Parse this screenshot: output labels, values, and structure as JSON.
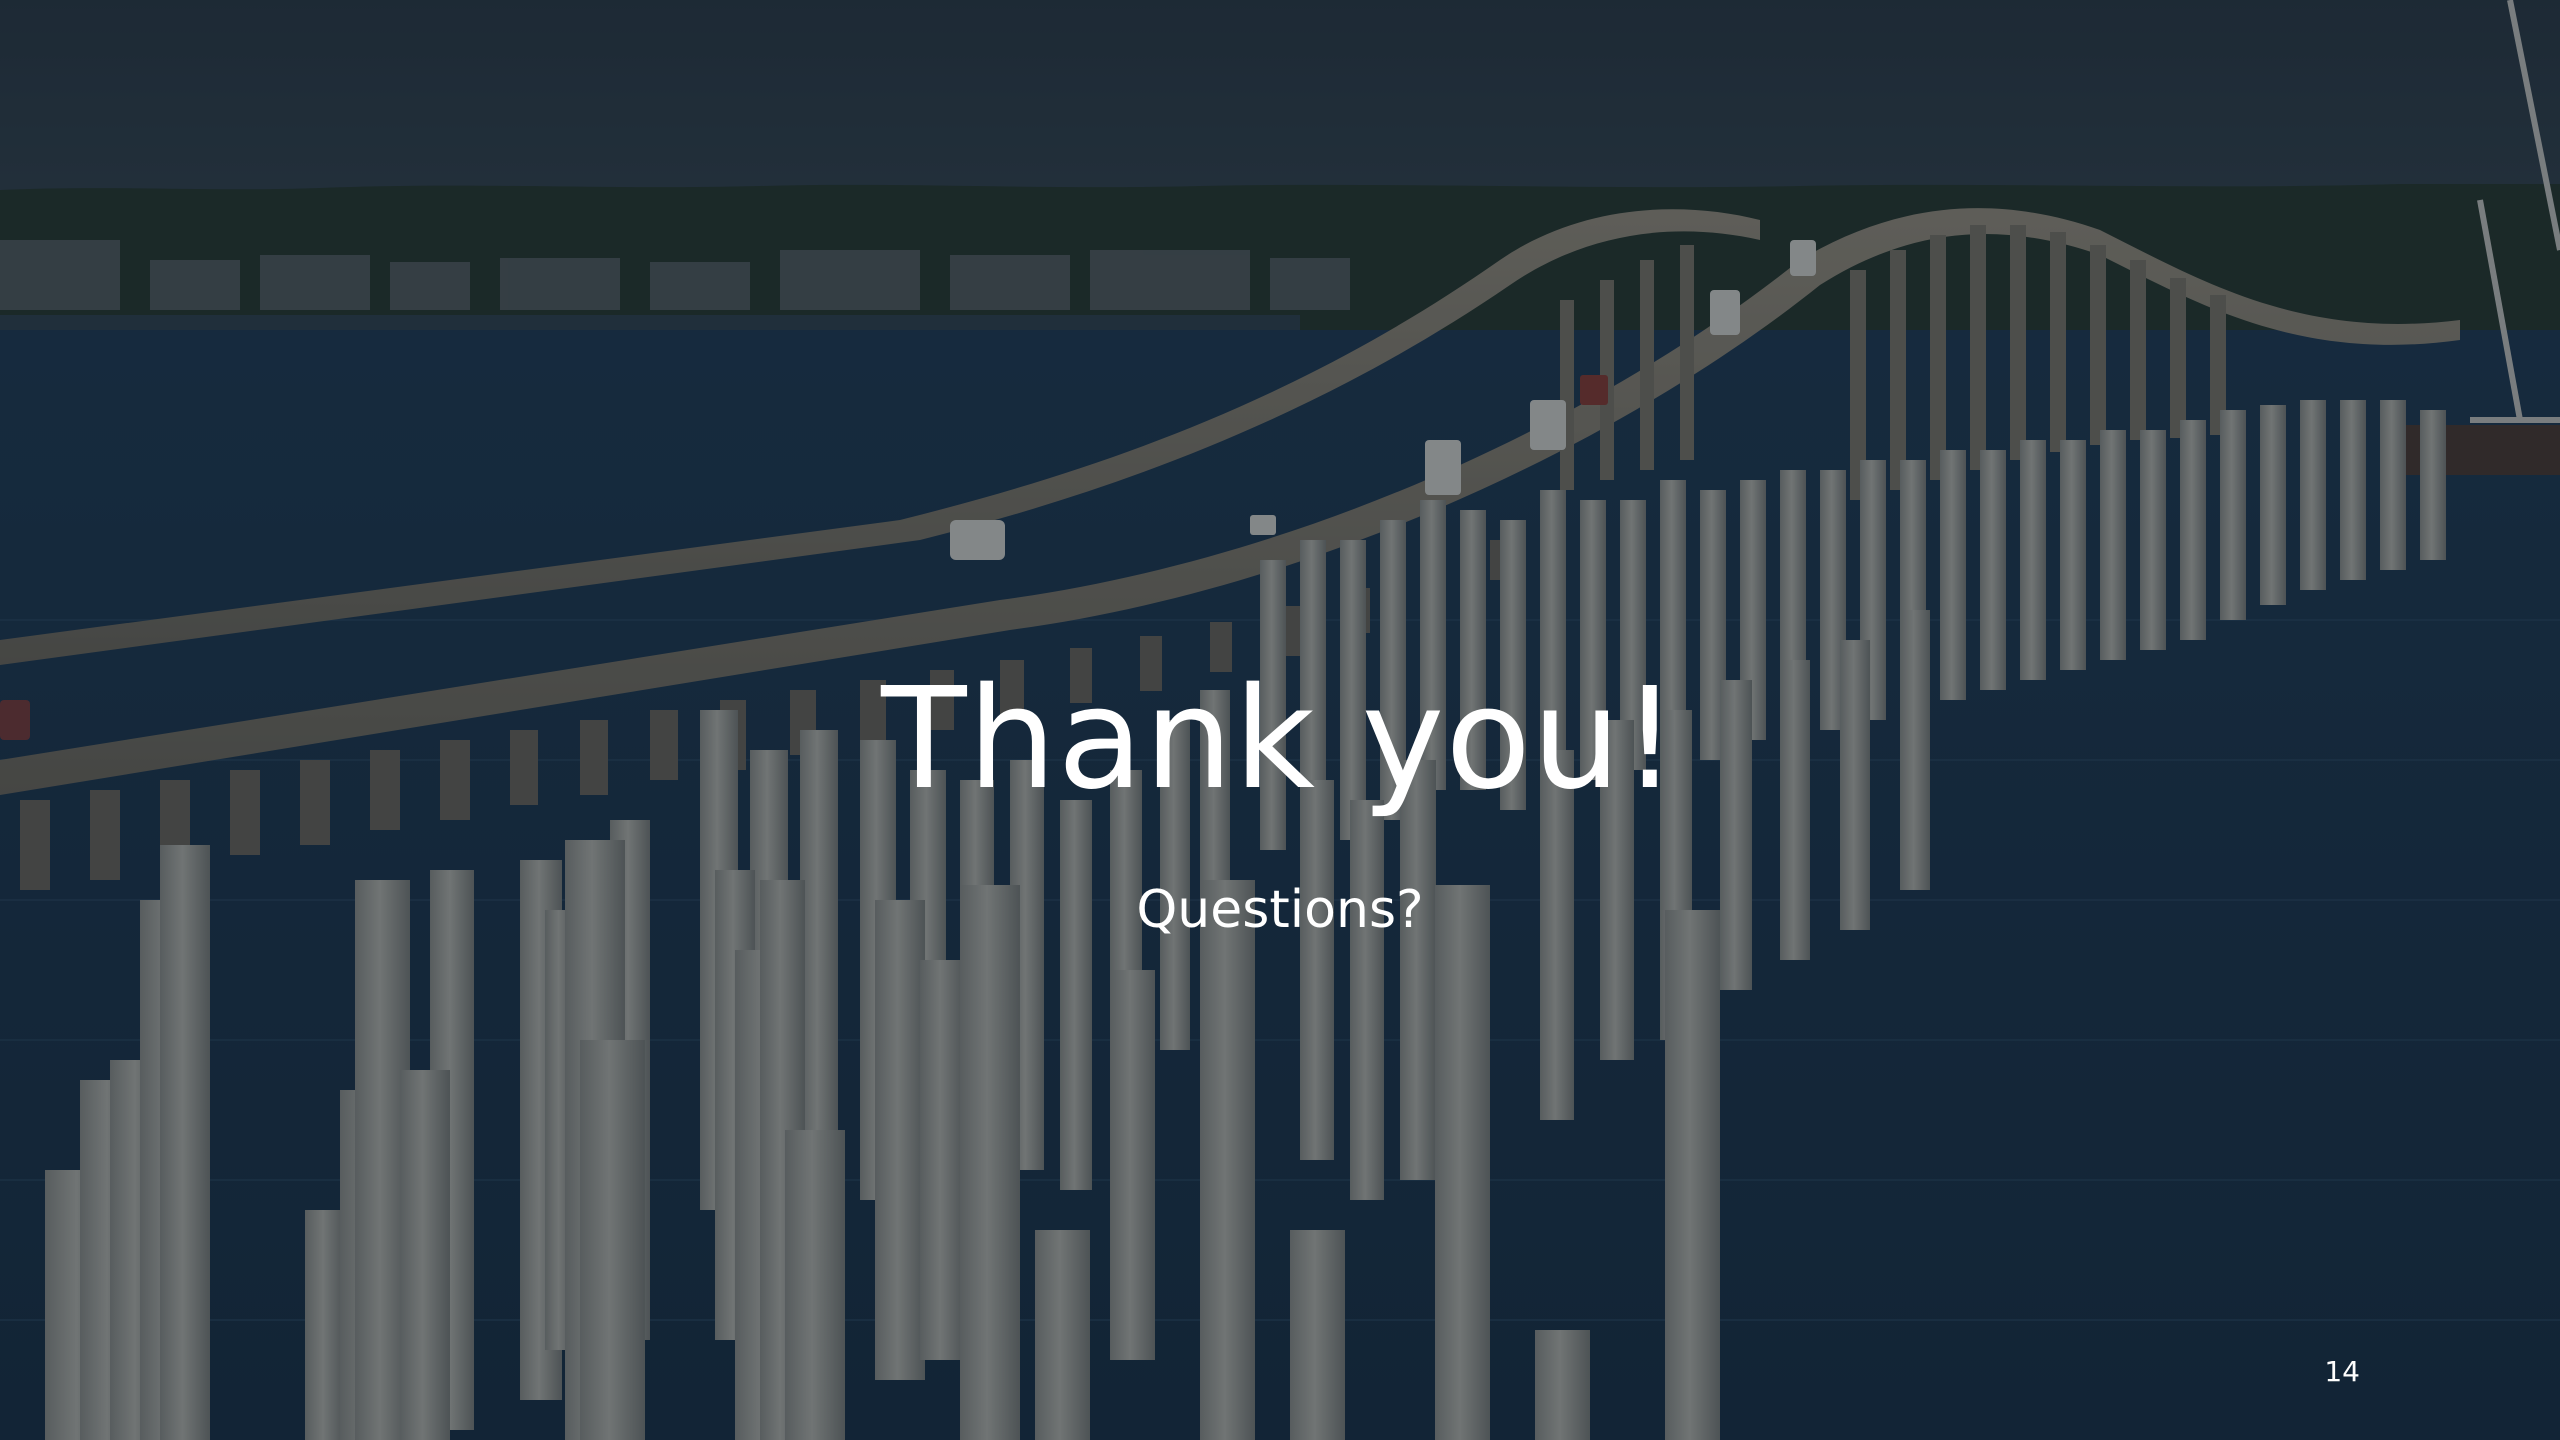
{
  "slide": {
    "title": "Thank you!",
    "subtitle": "Questions?",
    "page_number": "14"
  },
  "background": {
    "description_icon": "bridge-over-water-photo",
    "sky_color": "#2b3a47",
    "water_color": "#1f3a52",
    "bridge_color": "#8e8a7c",
    "pile_color": "#a9a9a3",
    "overlay_color": "#0b1620"
  }
}
